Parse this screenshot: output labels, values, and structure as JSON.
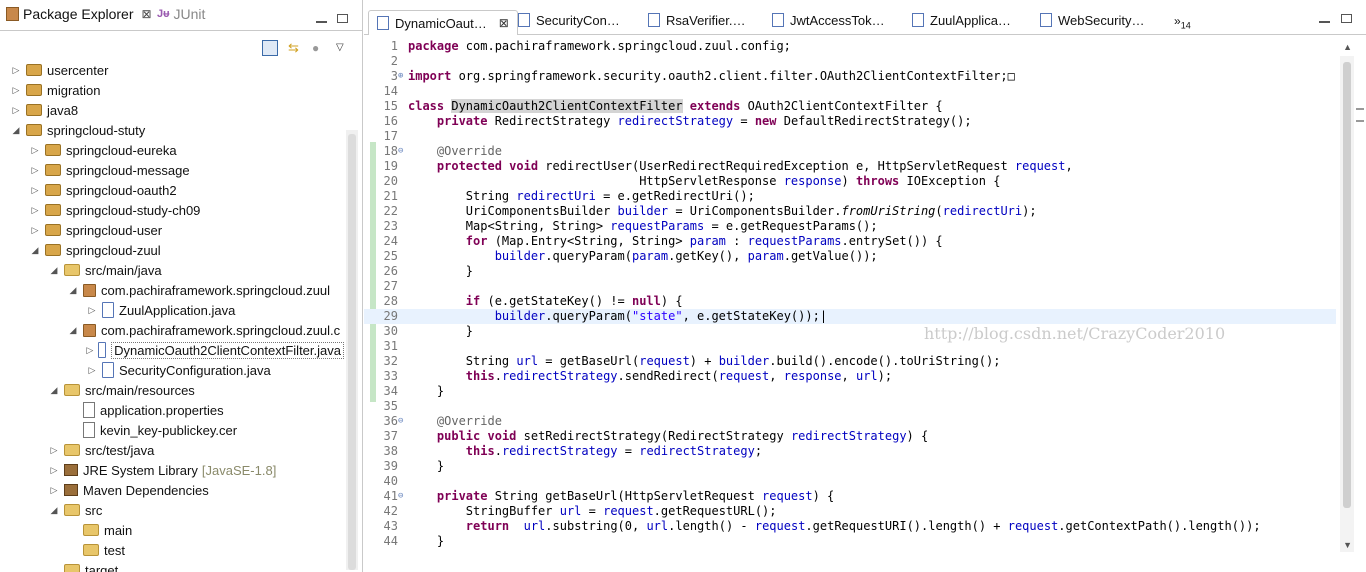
{
  "explorer": {
    "tab_label": "Package Explorer",
    "close_glyph": "⊠",
    "junit_label": "JUnit",
    "items": [
      {
        "label": "usercenter",
        "indent": 0,
        "arrow": "▷",
        "icon": "proj"
      },
      {
        "label": "migration",
        "indent": 0,
        "arrow": "▷",
        "icon": "proj"
      },
      {
        "label": "java8",
        "indent": 0,
        "arrow": "▷",
        "icon": "proj"
      },
      {
        "label": "springcloud-stuty",
        "indent": 0,
        "arrow": "◢",
        "icon": "proj"
      },
      {
        "label": "springcloud-eureka",
        "indent": 1,
        "arrow": "▷",
        "icon": "proj"
      },
      {
        "label": "springcloud-message",
        "indent": 1,
        "arrow": "▷",
        "icon": "proj"
      },
      {
        "label": "springcloud-oauth2",
        "indent": 1,
        "arrow": "▷",
        "icon": "proj"
      },
      {
        "label": "springcloud-study-ch09",
        "indent": 1,
        "arrow": "▷",
        "icon": "proj"
      },
      {
        "label": "springcloud-user",
        "indent": 1,
        "arrow": "▷",
        "icon": "proj"
      },
      {
        "label": "springcloud-zuul",
        "indent": 1,
        "arrow": "◢",
        "icon": "proj"
      },
      {
        "label": "src/main/java",
        "indent": 2,
        "arrow": "◢",
        "icon": "folder"
      },
      {
        "label": "com.pachiraframework.springcloud.zuul",
        "indent": 3,
        "arrow": "◢",
        "icon": "pkg"
      },
      {
        "label": "ZuulApplication.java",
        "indent": 4,
        "arrow": "▷",
        "icon": "java"
      },
      {
        "label": "com.pachiraframework.springcloud.zuul.c",
        "indent": 3,
        "arrow": "◢",
        "icon": "pkg"
      },
      {
        "label": "DynamicOauth2ClientContextFilter.java",
        "indent": 4,
        "arrow": "▷",
        "icon": "java",
        "selected": true
      },
      {
        "label": "SecurityConfiguration.java",
        "indent": 4,
        "arrow": "▷",
        "icon": "java"
      },
      {
        "label": "src/main/resources",
        "indent": 2,
        "arrow": "◢",
        "icon": "folder"
      },
      {
        "label": "application.properties",
        "indent": 3,
        "arrow": "",
        "icon": "file"
      },
      {
        "label": "kevin_key-publickey.cer",
        "indent": 3,
        "arrow": "",
        "icon": "file"
      },
      {
        "label": "src/test/java",
        "indent": 2,
        "arrow": "▷",
        "icon": "folder"
      },
      {
        "label": "JRE System Library",
        "indent": 2,
        "arrow": "▷",
        "icon": "lib",
        "suffix": "[JavaSE-1.8]"
      },
      {
        "label": "Maven Dependencies",
        "indent": 2,
        "arrow": "▷",
        "icon": "lib"
      },
      {
        "label": "src",
        "indent": 2,
        "arrow": "◢",
        "icon": "folder"
      },
      {
        "label": "main",
        "indent": 3,
        "arrow": "",
        "icon": "folder"
      },
      {
        "label": "test",
        "indent": 3,
        "arrow": "",
        "icon": "folder"
      },
      {
        "label": "target",
        "indent": 2,
        "arrow": "",
        "icon": "folder"
      }
    ]
  },
  "editor": {
    "tabs": [
      "DynamicOaut…",
      "SecurityCon…",
      "RsaVerifier.…",
      "JwtAccessTok…",
      "ZuulApplica…",
      "WebSecurity…"
    ],
    "overflow_count": "14",
    "overflow_glyph": "»",
    "watermark": "http://blog.csdn.net/CrazyCoder2010",
    "lines": [
      {
        "n": "1",
        "html": "<span class=\"kw\">package</span> com.pachiraframework.springcloud.zuul.config;"
      },
      {
        "n": "2",
        "html": ""
      },
      {
        "n": "3",
        "fold": "⊕",
        "html": "<span class=\"kw\">import</span> org.springframework.security.oauth2.client.filter.OAuth2ClientContextFilter;□"
      },
      {
        "n": "14",
        "html": ""
      },
      {
        "n": "15",
        "html": "<span class=\"kw\">class</span> <span class=\"hl\">DynamicOauth2ClientContextFilter</span> <span class=\"kw\">extends</span> OAuth2ClientContextFilter {"
      },
      {
        "n": "16",
        "html": "    <span class=\"kw\">private</span> RedirectStrategy <span class=\"fld\">redirectStrategy</span> = <span class=\"kw\">new</span> DefaultRedirectStrategy();"
      },
      {
        "n": "17",
        "html": ""
      },
      {
        "n": "18",
        "fold": "⊖",
        "html": "    <span class=\"ann\">@Override</span>"
      },
      {
        "n": "19",
        "html": "    <span class=\"kw\">protected</span> <span class=\"kw\">void</span> redirectUser(UserRedirectRequiredException e, HttpServletRequest <span class=\"fld\">request</span>,"
      },
      {
        "n": "20",
        "html": "                                HttpServletResponse <span class=\"fld\">response</span>) <span class=\"kw\">throws</span> IOException {"
      },
      {
        "n": "21",
        "html": "        String <span class=\"fld\">redirectUri</span> = e.getRedirectUri();"
      },
      {
        "n": "22",
        "html": "        UriComponentsBuilder <span class=\"fld\">builder</span> = UriComponentsBuilder.<span class=\"it\">fromUriString</span>(<span class=\"fld\">redirectUri</span>);"
      },
      {
        "n": "23",
        "html": "        Map&lt;String, String&gt; <span class=\"fld\">requestParams</span> = e.getRequestParams();"
      },
      {
        "n": "24",
        "html": "        <span class=\"kw\">for</span> (Map.Entry&lt;String, String&gt; <span class=\"fld\">param</span> : <span class=\"fld\">requestParams</span>.entrySet()) {"
      },
      {
        "n": "25",
        "html": "            <span class=\"fld\">builder</span>.queryParam(<span class=\"fld\">param</span>.getKey(), <span class=\"fld\">param</span>.getValue());"
      },
      {
        "n": "26",
        "html": "        }"
      },
      {
        "n": "27",
        "html": ""
      },
      {
        "n": "28",
        "html": "        <span class=\"kw\">if</span> (e.getStateKey() != <span class=\"kw\">null</span>) {"
      },
      {
        "n": "29",
        "current": true,
        "html": "            <span class=\"fld\">builder</span>.queryParam(<span class=\"str\">\"state\"</span>, e.getStateKey());|"
      },
      {
        "n": "30",
        "html": "        }"
      },
      {
        "n": "31",
        "html": ""
      },
      {
        "n": "32",
        "html": "        String <span class=\"fld\">url</span> = getBaseUrl(<span class=\"fld\">request</span>) + <span class=\"fld\">builder</span>.build().encode().toUriString();"
      },
      {
        "n": "33",
        "html": "        <span class=\"kw\">this</span>.<span class=\"fld\">redirectStrategy</span>.sendRedirect(<span class=\"fld\">request</span>, <span class=\"fld\">response</span>, <span class=\"fld\">url</span>);"
      },
      {
        "n": "34",
        "html": "    }"
      },
      {
        "n": "35",
        "html": ""
      },
      {
        "n": "36",
        "fold": "⊖",
        "html": "    <span class=\"ann\">@Override</span>"
      },
      {
        "n": "37",
        "html": "    <span class=\"kw\">public</span> <span class=\"kw\">void</span> setRedirectStrategy(RedirectStrategy <span class=\"fld\">redirectStrategy</span>) {"
      },
      {
        "n": "38",
        "html": "        <span class=\"kw\">this</span>.<span class=\"fld\">redirectStrategy</span> = <span class=\"fld\">redirectStrategy</span>;"
      },
      {
        "n": "39",
        "html": "    }"
      },
      {
        "n": "40",
        "html": ""
      },
      {
        "n": "41",
        "fold": "⊖",
        "html": "    <span class=\"kw\">private</span> String getBaseUrl(HttpServletRequest <span class=\"fld\">request</span>) {"
      },
      {
        "n": "42",
        "html": "        StringBuffer <span class=\"fld\">url</span> = <span class=\"fld\">request</span>.getRequestURL();"
      },
      {
        "n": "43",
        "html": "        <span class=\"kw\">return</span>  <span class=\"fld\">url</span>.substring(0, <span class=\"fld\">url</span>.length() - <span class=\"fld\">request</span>.getRequestURI().length() + <span class=\"fld\">request</span>.getContextPath().length());"
      },
      {
        "n": "44",
        "html": "    }"
      }
    ]
  }
}
